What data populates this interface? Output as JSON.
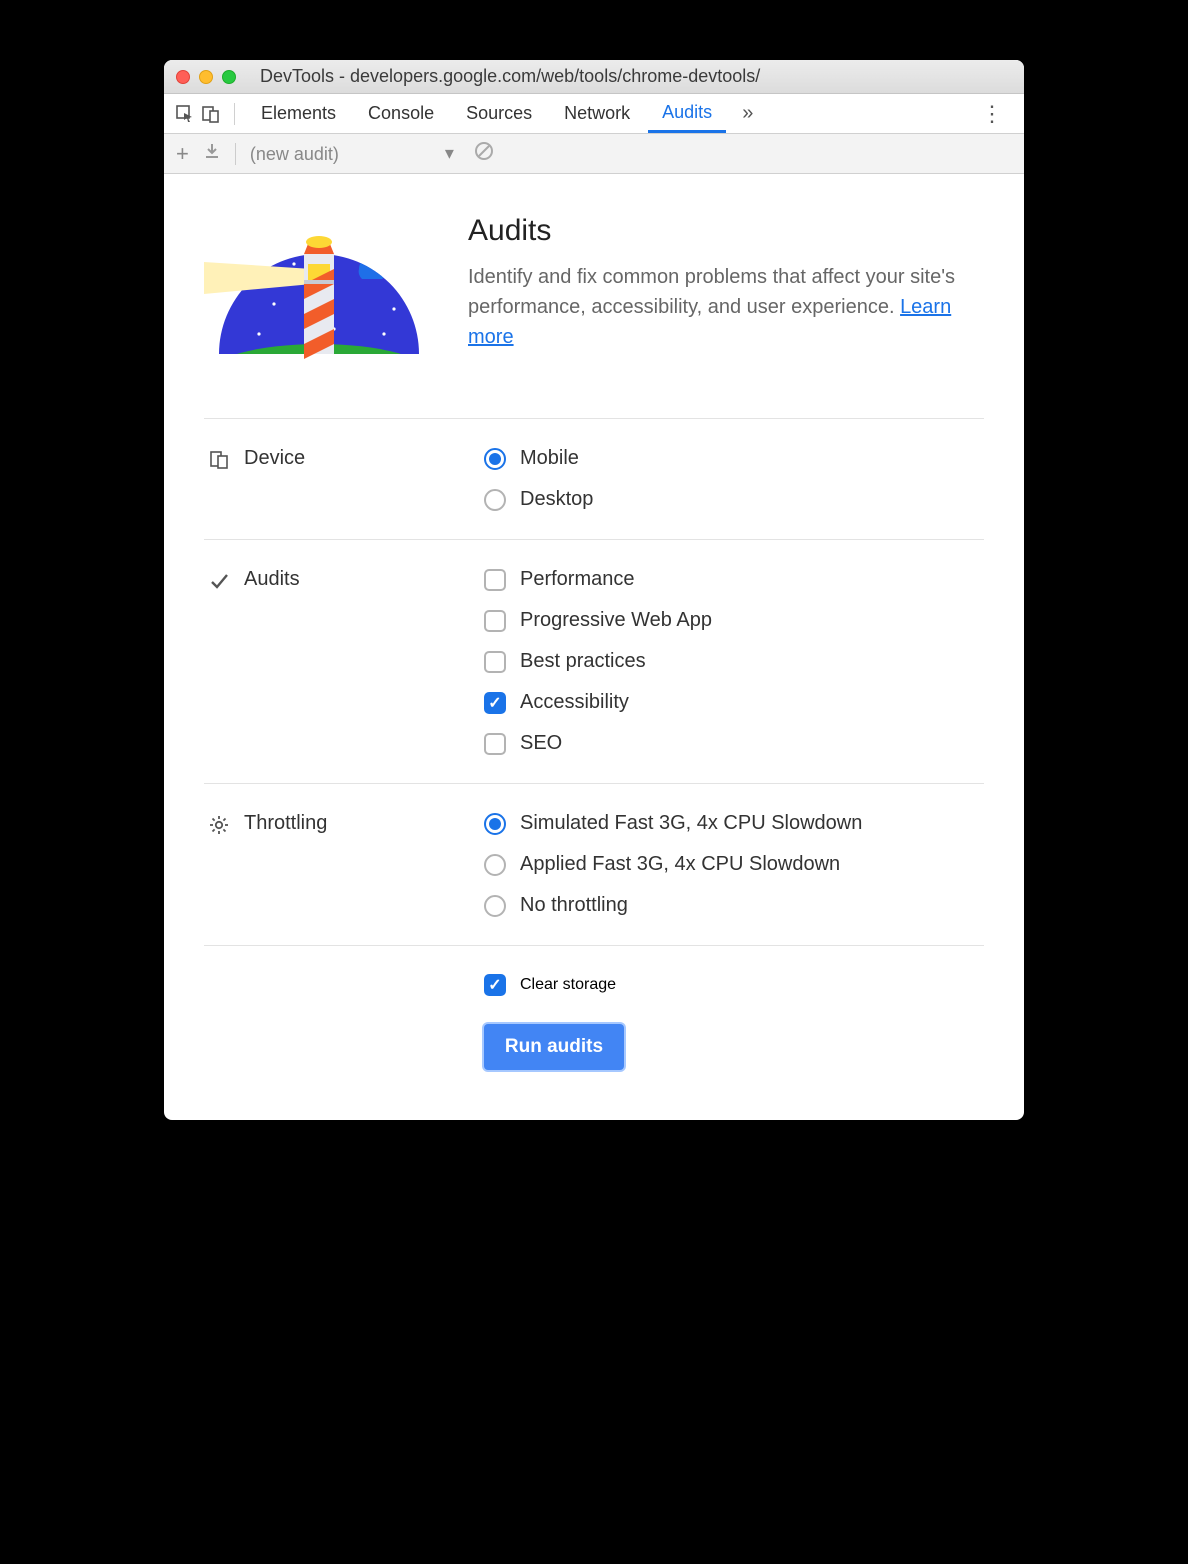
{
  "window": {
    "title": "DevTools - developers.google.com/web/tools/chrome-devtools/"
  },
  "tabs": {
    "items": [
      "Elements",
      "Console",
      "Sources",
      "Network",
      "Audits"
    ],
    "active": "Audits"
  },
  "toolbar": {
    "dropdown_value": "(new audit)"
  },
  "intro": {
    "heading": "Audits",
    "body": "Identify and fix common problems that affect your site's performance, accessibility, and user experience. ",
    "link_text": "Learn more"
  },
  "device": {
    "label": "Device",
    "options": [
      {
        "label": "Mobile",
        "checked": true
      },
      {
        "label": "Desktop",
        "checked": false
      }
    ]
  },
  "audits": {
    "label": "Audits",
    "options": [
      {
        "label": "Performance",
        "checked": false
      },
      {
        "label": "Progressive Web App",
        "checked": false
      },
      {
        "label": "Best practices",
        "checked": false
      },
      {
        "label": "Accessibility",
        "checked": true
      },
      {
        "label": "SEO",
        "checked": false
      }
    ]
  },
  "throttling": {
    "label": "Throttling",
    "options": [
      {
        "label": "Simulated Fast 3G, 4x CPU Slowdown",
        "checked": true
      },
      {
        "label": "Applied Fast 3G, 4x CPU Slowdown",
        "checked": false
      },
      {
        "label": "No throttling",
        "checked": false
      }
    ]
  },
  "clear_storage": {
    "label": "Clear storage",
    "checked": true
  },
  "run_button": "Run audits"
}
